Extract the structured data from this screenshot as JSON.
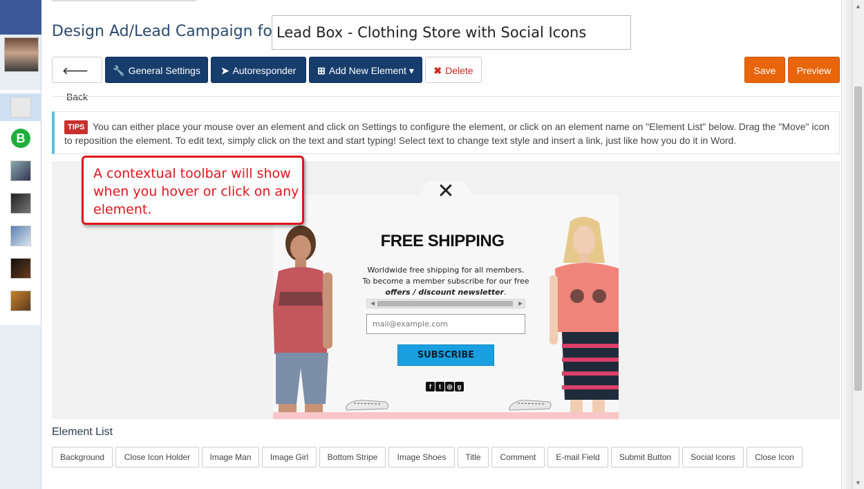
{
  "header": {
    "design_label": "Design Ad/Lead Campaign for",
    "campaign_name": "Lead Box - Clothing Store with Social Icons"
  },
  "toolbar": {
    "back_label": "Back",
    "general_settings_label": "General Settings",
    "autoresponder_label": "Autoresponder",
    "add_element_label": "Add New Element",
    "delete_label": "Delete",
    "save_label": "Save",
    "preview_label": "Preview"
  },
  "tips": {
    "badge": "TIPS",
    "text": "You can either place your mouse over an element and click on Settings to configure the element, or click on an element name on \"Element List\" below. Drag the \"Move\" icon to reposition the element. To edit text, simply click on the text and start typing! Select text to change text style and insert a link, just like how you do it in Word."
  },
  "callout": {
    "text": "A contextual toolbar will show when you hover or click on any element."
  },
  "popup": {
    "title": "FREE SHIPPING",
    "comment_line1": "Worldwide free shipping for all members.",
    "comment_line2": "To become a member subscribe for our free",
    "comment_line3": "offers / discount newsletter",
    "comment_line3_end": ".",
    "email_placeholder": "mail@example.com",
    "subscribe_label": "SUBSCRIBE",
    "close_symbol": "✕"
  },
  "element_list": {
    "title": "Element List",
    "items": [
      "Background",
      "Close Icon Holder",
      "Image Man",
      "Image Girl",
      "Bottom Stripe",
      "Image Shoes",
      "Title",
      "Comment",
      "E-mail Field",
      "Submit Button",
      "Social Icons",
      "Close Icon"
    ]
  },
  "icons": {
    "back": "arrow-left-icon",
    "general_settings": "wrench-icon",
    "autoresponder": "paper-plane-icon",
    "add_element": "plus-square-icon",
    "delete": "times-icon",
    "social": [
      "facebook-icon",
      "twitter-icon",
      "instagram-icon",
      "google-plus-icon"
    ]
  },
  "colors": {
    "navy_button": "#173d6d",
    "orange_button": "#e8650a",
    "delete_text": "#d0261c",
    "callout_red": "#e0141c",
    "tips_accent": "#5bc0de",
    "subscribe_blue": "#1aa0e0"
  }
}
